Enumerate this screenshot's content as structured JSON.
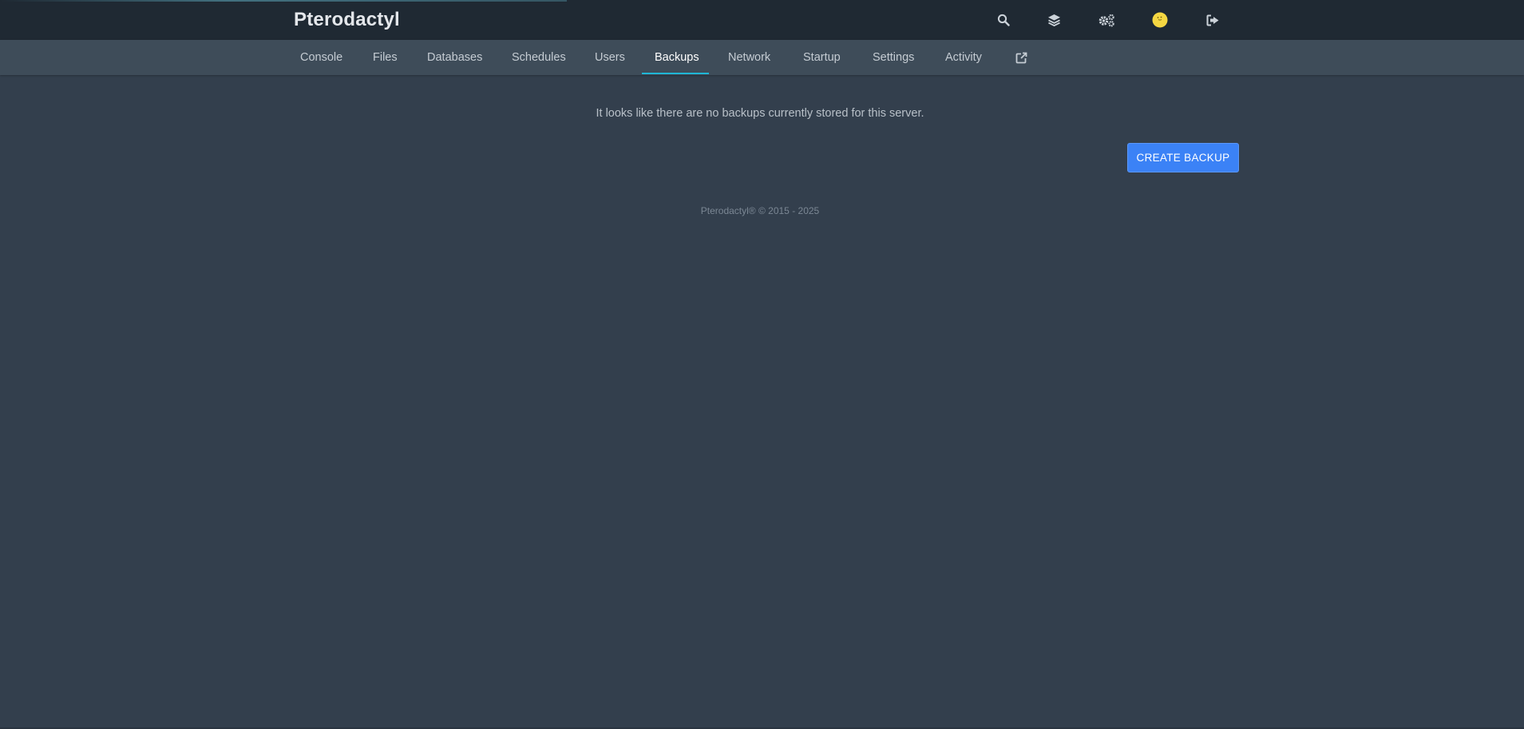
{
  "header": {
    "brand": "Pterodactyl",
    "icons": [
      "search-icon",
      "layers-icon",
      "admin-cogs-icon",
      "user-avatar",
      "logout-icon"
    ]
  },
  "nav": {
    "tabs": [
      {
        "label": "Console",
        "active": false
      },
      {
        "label": "Files",
        "active": false
      },
      {
        "label": "Databases",
        "active": false
      },
      {
        "label": "Schedules",
        "active": false
      },
      {
        "label": "Users",
        "active": false
      },
      {
        "label": "Backups",
        "active": true
      },
      {
        "label": "Network",
        "active": false
      },
      {
        "label": "Startup",
        "active": false
      },
      {
        "label": "Settings",
        "active": false
      },
      {
        "label": "Activity",
        "active": false
      }
    ],
    "external_icon": "external-link-icon"
  },
  "main": {
    "empty_message": "It looks like there are no backups currently stored for this server.",
    "create_button": "CREATE BACKUP"
  },
  "footer": {
    "text": "Pterodactyl® © 2015 - 2025"
  },
  "colors": {
    "accent": "#3b82f6",
    "active_tab_underline": "#1fb6d6",
    "background": "#333f4d",
    "topbar": "#1f2933",
    "subnav": "#3e4c59",
    "avatar": "#f5d742"
  }
}
